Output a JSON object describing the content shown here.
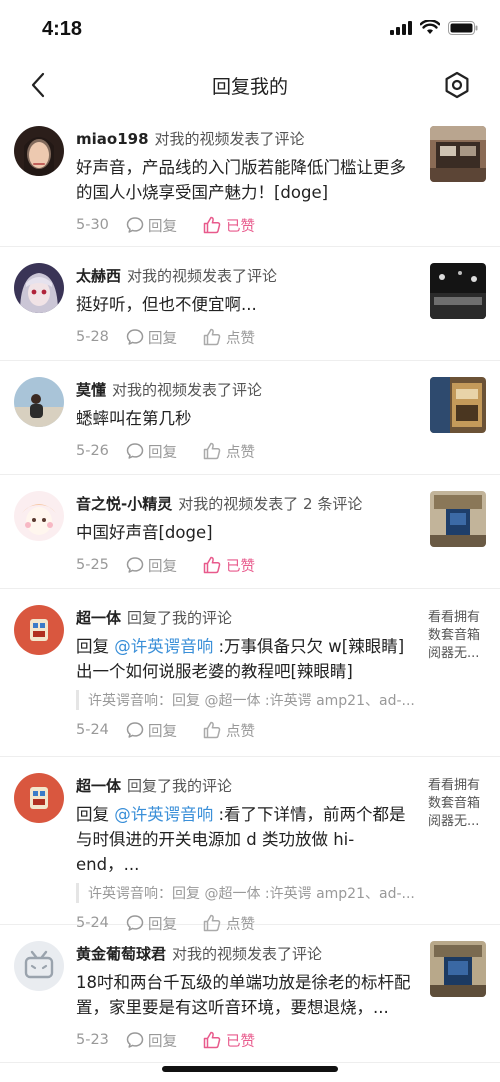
{
  "status": {
    "time": "4:18"
  },
  "nav": {
    "title": "回复我的"
  },
  "items": [
    {
      "name": "miao198",
      "action": "对我的视频发表了评论",
      "text": "好声音，产品线的入门版若能降低门槛让更多的国人小烧享受国产魅力！[doge]",
      "date": "5-30",
      "reply": "回复",
      "like": "已赞",
      "liked": true
    },
    {
      "name": "太赫西",
      "action": "对我的视频发表了评论",
      "text": "挺好听，但也不便宜啊...",
      "date": "5-28",
      "reply": "回复",
      "like": "点赞",
      "liked": false
    },
    {
      "name": "莫懂",
      "action": "对我的视频发表了评论",
      "text": "蟋蟀叫在第几秒",
      "date": "5-26",
      "reply": "回复",
      "like": "点赞",
      "liked": false
    },
    {
      "name": "音之悦-小精灵",
      "action": "对我的视频发表了 2 条评论",
      "text": "中国好声音[doge]",
      "date": "5-25",
      "reply": "回复",
      "like": "已赞",
      "liked": true
    },
    {
      "name": "超一体",
      "action": "回复了我的评论",
      "text_prefix": "回复 ",
      "mention": "@许英谔音响",
      "text": " :万事俱备只欠 w[辣眼睛]出一个如何说服老婆的教程吧[辣眼睛]",
      "quote": "许英谔音响：回复 @超一体 :许英谔 amp21、ad-...",
      "side_text": "看看拥有数套音箱阅器无...",
      "date": "5-24",
      "reply": "回复",
      "like": "点赞",
      "liked": false
    },
    {
      "name": "超一体",
      "action": "回复了我的评论",
      "text_prefix": "回复 ",
      "mention": "@许英谔音响",
      "text": " :看了下详情，前两个都是与时俱进的开关电源加 d 类功放做 hi-end，...",
      "quote": "许英谔音响：回复 @超一体 :许英谔 amp21、ad-...",
      "side_text": "看看拥有数套音箱阅器无...",
      "date": "5-24",
      "reply": "回复",
      "like": "点赞",
      "liked": false
    },
    {
      "name": "黄金葡萄球君",
      "action": "对我的视频发表了评论",
      "text": "18吋和两台千瓦级的单端功放是徐老的标杆配置，家里要是有这听音环境，要想退烧，...",
      "date": "5-23",
      "reply": "回复",
      "like": "已赞",
      "liked": true
    }
  ],
  "colors": {
    "accent_like": "#e85a8c",
    "mention": "#3a8fd8"
  }
}
